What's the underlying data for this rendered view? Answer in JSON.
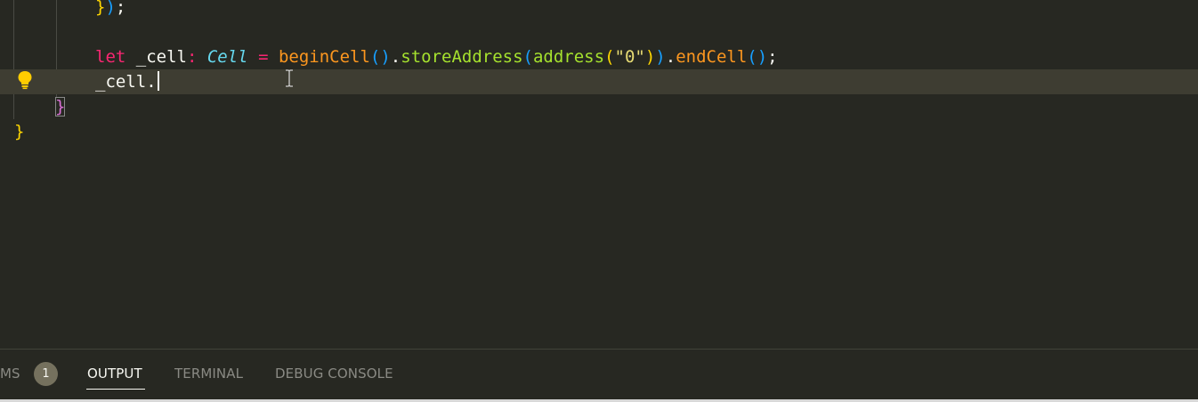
{
  "colors": {
    "background": "#272822",
    "current_line": "#3e3d32",
    "default_text": "#f8f8f2",
    "keyword": "#f92672",
    "type": "#66d9ef",
    "function_call": "#fd971f",
    "method": "#a6e22e",
    "string": "#e6db74",
    "brace_yellow": "#ffd700",
    "brace_magenta": "#da70d6",
    "paren_blue": "#179fff",
    "lightbulb": "#ffcc00"
  },
  "editor": {
    "lines": [
      {
        "id": "closing-call",
        "tokens": [
          {
            "text": "}",
            "color": "#ffd700"
          },
          {
            "text": ")",
            "color": "#179fff"
          },
          {
            "text": ";",
            "color": "#f8f8f2"
          }
        ]
      },
      {
        "id": "let-cell",
        "tokens": [
          {
            "text": "let ",
            "color": "#f92672"
          },
          {
            "text": "_cell",
            "color": "#f8f8f2"
          },
          {
            "text": ": ",
            "color": "#f92672"
          },
          {
            "text": "Cell",
            "color": "#66d9ef",
            "italic": true
          },
          {
            "text": " = ",
            "color": "#f92672"
          },
          {
            "text": "beginCell",
            "color": "#fd971f"
          },
          {
            "text": "()",
            "color": "#179fff"
          },
          {
            "text": ".",
            "color": "#f8f8f2"
          },
          {
            "text": "storeAddress",
            "color": "#a6e22e"
          },
          {
            "text": "(",
            "color": "#179fff"
          },
          {
            "text": "address",
            "color": "#a6e22e"
          },
          {
            "text": "(",
            "color": "#ffd700"
          },
          {
            "text": "\"0\"",
            "color": "#e6db74"
          },
          {
            "text": ")",
            "color": "#ffd700"
          },
          {
            "text": ")",
            "color": "#179fff"
          },
          {
            "text": ".",
            "color": "#f8f8f2"
          },
          {
            "text": "endCell",
            "color": "#fd971f"
          },
          {
            "text": "()",
            "color": "#179fff"
          },
          {
            "text": ";",
            "color": "#f8f8f2"
          }
        ]
      },
      {
        "id": "cell-dot",
        "tokens": [
          {
            "text": "_cell.",
            "color": "#f8f8f2"
          }
        ]
      },
      {
        "id": "inner-brace",
        "tokens": [
          {
            "text": "}",
            "color": "#da70d6",
            "boxed": true
          }
        ]
      },
      {
        "id": "outer-brace",
        "tokens": [
          {
            "text": "}",
            "color": "#ffd700"
          }
        ]
      }
    ]
  },
  "panel": {
    "tabs": {
      "problems_partial": "MS",
      "problems_count": "1",
      "output": "OUTPUT",
      "terminal": "TERMINAL",
      "debug_console": "DEBUG CONSOLE"
    },
    "active_tab": "OUTPUT"
  },
  "icons": {
    "lightbulb": "lightbulb-icon",
    "text_cursor": "text-cursor-icon"
  }
}
